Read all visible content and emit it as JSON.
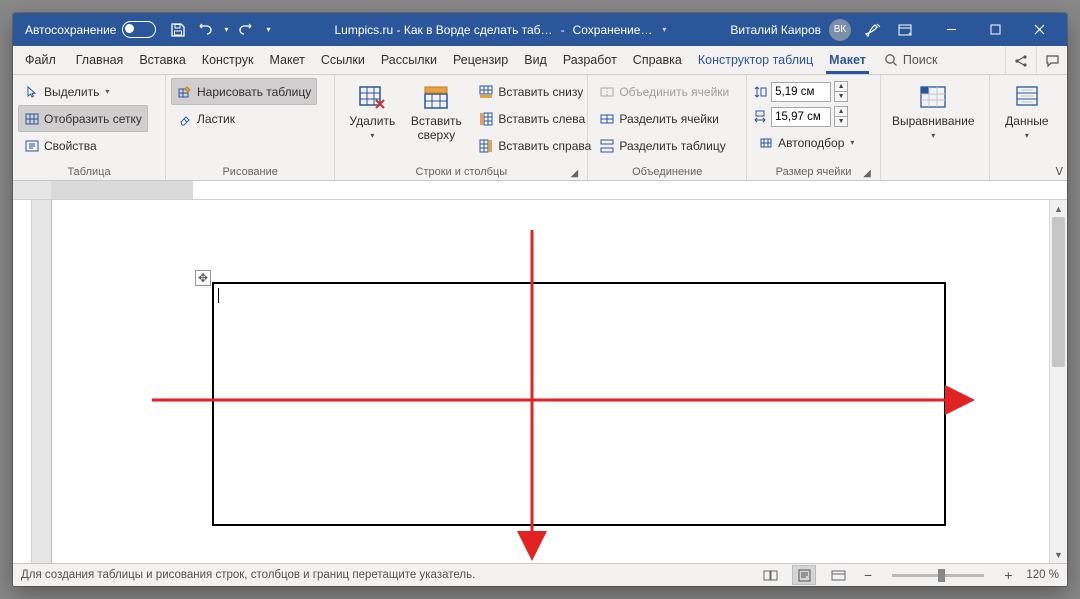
{
  "titlebar": {
    "autosave": "Автосохранение",
    "doc_title": "Lumpics.ru - Как в Ворде сделать таб…",
    "save_state": "Сохранение…",
    "user_name": "Виталий Каиров",
    "user_initials": "ВК"
  },
  "tabs": {
    "file": "Файл",
    "home": "Главная",
    "insert": "Вставка",
    "design": "Конструк",
    "layout": "Макет",
    "references": "Ссылки",
    "mailings": "Рассылки",
    "review": "Рецензир",
    "view": "Вид",
    "developer": "Разработ",
    "help": "Справка",
    "table_design": "Конструктор таблиц",
    "table_layout": "Макет",
    "search": "Поиск"
  },
  "ribbon": {
    "g_table": {
      "label": "Таблица",
      "select": "Выделить",
      "gridlines": "Отобразить сетку",
      "properties": "Свойства"
    },
    "g_draw": {
      "label": "Рисование",
      "draw_table": "Нарисовать таблицу",
      "eraser": "Ластик"
    },
    "g_rowscols": {
      "label": "Строки и столбцы",
      "delete": "Удалить",
      "insert_above": "Вставить\nсверху",
      "insert_below": "Вставить снизу",
      "insert_left": "Вставить слева",
      "insert_right": "Вставить справа"
    },
    "g_merge": {
      "label": "Объединение",
      "merge": "Объединить ячейки",
      "split": "Разделить ячейки",
      "split_table": "Разделить таблицу"
    },
    "g_size": {
      "label": "Размер ячейки",
      "height": "5,19 см",
      "width": "15,97 см",
      "autofit": "Автоподбор"
    },
    "g_align": {
      "label": "Выравнивание"
    },
    "g_data": {
      "label": "Данные"
    }
  },
  "status": {
    "hint": "Для создания таблицы и рисования строк, столбцов и границ перетащите указатель.",
    "zoom": "120 %"
  },
  "colors": {
    "brand": "#2B579A",
    "annotation": "#E32222"
  }
}
